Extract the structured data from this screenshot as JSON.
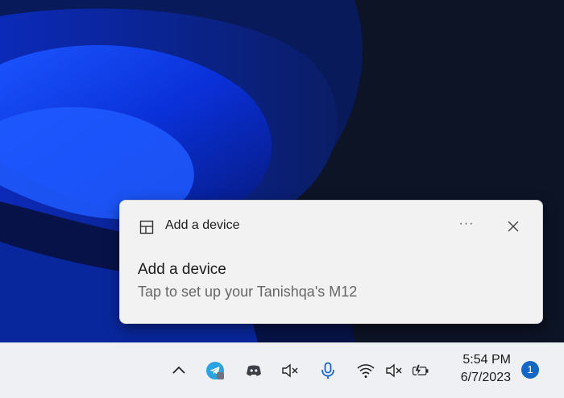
{
  "toast": {
    "app_name": "Add a device",
    "more_label": "···",
    "title": "Add a device",
    "body": "Tap to set up your Tanishqa's M12"
  },
  "taskbar": {
    "icons": [
      "chevron-up-icon",
      "telegram-icon",
      "discord-icon",
      "speaker-muted-icon",
      "microphone-icon",
      "wifi-icon",
      "volume-muted-icon",
      "battery-charging-icon"
    ],
    "time": "5:54 PM",
    "date": "6/7/2023",
    "notification_count": "1"
  },
  "colors": {
    "accent": "#1567c6",
    "wallpaper_blue": "#0a3cff",
    "taskbar_bg": "#eef0f3",
    "toast_bg": "#f2f2f2"
  }
}
